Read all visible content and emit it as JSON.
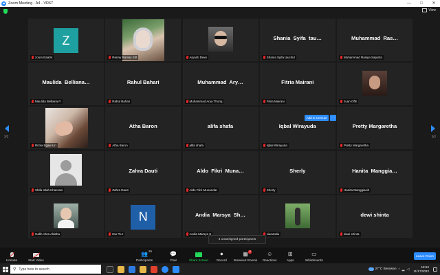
{
  "window": {
    "title": "Zoom Meeting - A4 - VR67",
    "minimize_glyph": "—",
    "maximize_glyph": "□",
    "close_glyph": "✕",
    "view_label": "View"
  },
  "pagination": {
    "left": "2/2",
    "right": "2/2"
  },
  "tiles": [
    {
      "big": "",
      "label": "zoom Eaa04",
      "avatar_letter": "Z",
      "avatar_color": "#1fa0a0"
    },
    {
      "big": "",
      "label": "Renny Ramsy Sitt",
      "photo": "hijab"
    },
    {
      "big": "",
      "label": "Aryanti Dewi",
      "photo": "sunglasses"
    },
    {
      "big": "Shania  Syifa  tau…",
      "label": "Shania Syifa tauchid"
    },
    {
      "big": "Muhammad  Ras…",
      "label": "Muhammad Rasiya Saputra"
    },
    {
      "big": "Maulida  Belliana…",
      "label": "Maulida Belliana P."
    },
    {
      "big": "Rahul Bahari",
      "label": "Rahul Bahari"
    },
    {
      "big": "Muhammad  Ary…",
      "label": "Muhammad Arya Thoriq"
    },
    {
      "big": "Fitria Mairani",
      "label": "Fitria Mairani"
    },
    {
      "big": "",
      "label": "Juan Offn",
      "photo": "face"
    },
    {
      "big": "",
      "label": "Rizka Egaw Un",
      "photo": "lying"
    },
    {
      "big": "Atha Baron",
      "label": "Atha Baron"
    },
    {
      "big": "alifa shafa",
      "label": "alifa shafa"
    },
    {
      "big": "Iqbal Wirayuda",
      "label": "Iqbal Wirayuda"
    },
    {
      "big": "Pretty Margaretha",
      "label": "Pretty Margaretha"
    },
    {
      "big": "",
      "label": "Shifa Islah Khaerani",
      "photo": "default"
    },
    {
      "big": "Zahra Dauti",
      "label": "Zahra Dauti"
    },
    {
      "big": "Aldo  Fikri  Muna…",
      "label": "Aldo Fikri Munandar"
    },
    {
      "big": "Sherly",
      "label": "Sherly"
    },
    {
      "big": "Hanita  Manggia…",
      "label": "Hanita Manggiasih"
    },
    {
      "big": "",
      "label": "Galih Abra Aldaha",
      "photo": "boy"
    },
    {
      "big": "",
      "label": "Nur Tiur",
      "avatar_letter": "N",
      "avatar_color": "#1f5fa8"
    },
    {
      "big": "Andia  Marsya  Sh…",
      "label": "Andia Marsya S"
    },
    {
      "big": "",
      "label": "viananda",
      "photo": "outdoor"
    },
    {
      "big": "dewi shinta",
      "label": "dewi shinta"
    }
  ],
  "overlay": {
    "add_to_unmute": "Add to Unmute",
    "more": "···",
    "unassigned": "4 unassigned participants"
  },
  "toolbar": {
    "unmute": "Unmute",
    "start_video": "Start Video",
    "participants": "Participants",
    "participants_count": "26",
    "chat": "Chat",
    "share_screen": "Share Screen",
    "record": "Record",
    "breakout_rooms": "Breakout Rooms",
    "breakout_badge": "4",
    "reactions": "Reactions",
    "apps": "Apps",
    "whiteboards": "Whiteboards",
    "leave": "Leave Room"
  },
  "taskbar": {
    "search_placeholder": "Type here to search",
    "weather": "27°C  Berawan",
    "time": "18:52",
    "date": "11/17/2022",
    "up_arrow": "^"
  },
  "colors": {
    "accent": "#2d8cff",
    "green": "#23d959",
    "muted_red": "#e02828"
  }
}
